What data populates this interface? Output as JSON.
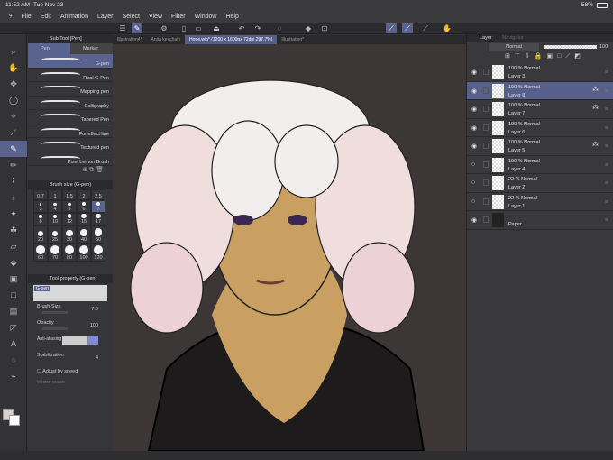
{
  "status": {
    "time": "11:52 AM",
    "date": "Tue Nov 23",
    "battery": "58%"
  },
  "menu": [
    "File",
    "Edit",
    "Animation",
    "Layer",
    "Select",
    "View",
    "Filter",
    "Window",
    "Help"
  ],
  "tabs": [
    "Illustration4*",
    "Anita keychain",
    "Hope.wip* (1200 x 1600px 72dpi 297.7%)",
    "Illustration*"
  ],
  "subtool": {
    "title": "Sub Tool [Pen]",
    "groups": [
      "Pen",
      "Marker"
    ],
    "brushes": [
      "G-pen",
      "Real G-Pen",
      "Mapping pen",
      "Calligraphy",
      "Tapered Pen",
      "For effect line",
      "Textured pen",
      "Pixel Lemon Brush"
    ],
    "selected": 0
  },
  "brush_size": {
    "title": "Brush size (G-pen)",
    "sizes": [
      "0.7",
      "1",
      "1.5",
      "2",
      "2.5",
      "3",
      "4",
      "5",
      "6",
      "7",
      "8",
      "10",
      "12",
      "15",
      "17",
      "20",
      "25",
      "30",
      "40",
      "50",
      "60",
      "70",
      "80",
      "100",
      "120"
    ],
    "selected": "7"
  },
  "tool_property": {
    "title": "Tool property (G-pen)",
    "preview_label": "G-pen",
    "brush_size_label": "Brush Size",
    "brush_size": "7.0",
    "opacity_label": "Opacity",
    "opacity": "100",
    "anti_aliasing_label": "Anti-aliasing",
    "stabilization_label": "Stabilization",
    "stabilization": "4",
    "adjust_label": "Adjust by speed",
    "vector_label": "Vector erase"
  },
  "layers_panel": {
    "tab1": "Layer",
    "tab2": "Navigator",
    "blend": "Normal",
    "opacity": "100",
    "layers": [
      {
        "pct": "100 %  Normal",
        "name": "Layer 3",
        "visible": true
      },
      {
        "pct": "100 %  Normal",
        "name": "Layer 8",
        "visible": true,
        "selected": true
      },
      {
        "pct": "100 %  Normal",
        "name": "Layer 7",
        "visible": true
      },
      {
        "pct": "100 %  Normal",
        "name": "Layer 6",
        "visible": true
      },
      {
        "pct": "100 %  Normal",
        "name": "Layer 5",
        "visible": true
      },
      {
        "pct": "100 %  Normal",
        "name": "Layer 4",
        "visible": false
      },
      {
        "pct": "22 %  Normal",
        "name": "Layer 2",
        "visible": false
      },
      {
        "pct": "22 %  Normal",
        "name": "Layer 1",
        "visible": false
      },
      {
        "pct": "",
        "name": "Paper",
        "visible": true
      }
    ]
  },
  "colors": {
    "accent": "#5a6390",
    "canvas_bg": "#3c3636",
    "skin": "#c9a062"
  }
}
